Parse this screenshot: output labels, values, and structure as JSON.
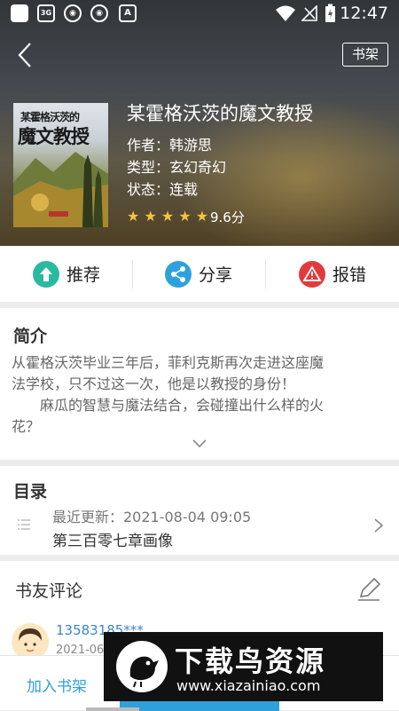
{
  "status_bar": {
    "time": "12:47",
    "icons": [
      "app-icon",
      "3g-icon",
      "shield-icon",
      "shield-icon",
      "font-icon",
      "wifi-icon",
      "signal-off-icon",
      "battery-charging-icon"
    ]
  },
  "header": {
    "back_icon": "chevron-left-icon",
    "shelf_label": "书架"
  },
  "book": {
    "cover_title_line1": "某霍格沃茨的",
    "cover_title_line2": "魔文教授",
    "title": "某霍格沃茨的魔文教授",
    "author": "作者：韩游思",
    "genre": "类型：玄幻奇幻",
    "status": "状态：连载",
    "rating_stars": 5,
    "score": "9.6分"
  },
  "actions": [
    {
      "label": "推荐",
      "icon": "thumb-up-icon",
      "color": "#2bb9a0"
    },
    {
      "label": "分享",
      "icon": "share-icon",
      "color": "#2ea1dc"
    },
    {
      "label": "报错",
      "icon": "warning-icon",
      "color": "#e23b3b"
    }
  ],
  "intro": {
    "title": "简介",
    "line1": "从霍格沃茨毕业三年后，菲利克斯再次走进这座魔",
    "line2": "法学校，只不过这一次，他是以教授的身份！",
    "line3": "　　麻瓜的智慧与魔法结合，会碰撞出什么样的火",
    "line4": "花？",
    "expand_icon": "chevron-down-icon"
  },
  "toc": {
    "title": "目录",
    "recent": "最近更新：2021-08-04 09:05",
    "chapter": "第三百零七章画像"
  },
  "comments": {
    "title": "书友评论",
    "edit_icon": "pencil-icon",
    "user": "13583185***",
    "date": "2021-06"
  },
  "bottom": {
    "add_shelf": "加入书架"
  },
  "watermark": {
    "main": "下载鸟资源",
    "url": "www.xiazainiao.com"
  },
  "colors": {
    "accent": "#2ea1dc",
    "star": "#f5c33b",
    "divider": "#ececec"
  }
}
